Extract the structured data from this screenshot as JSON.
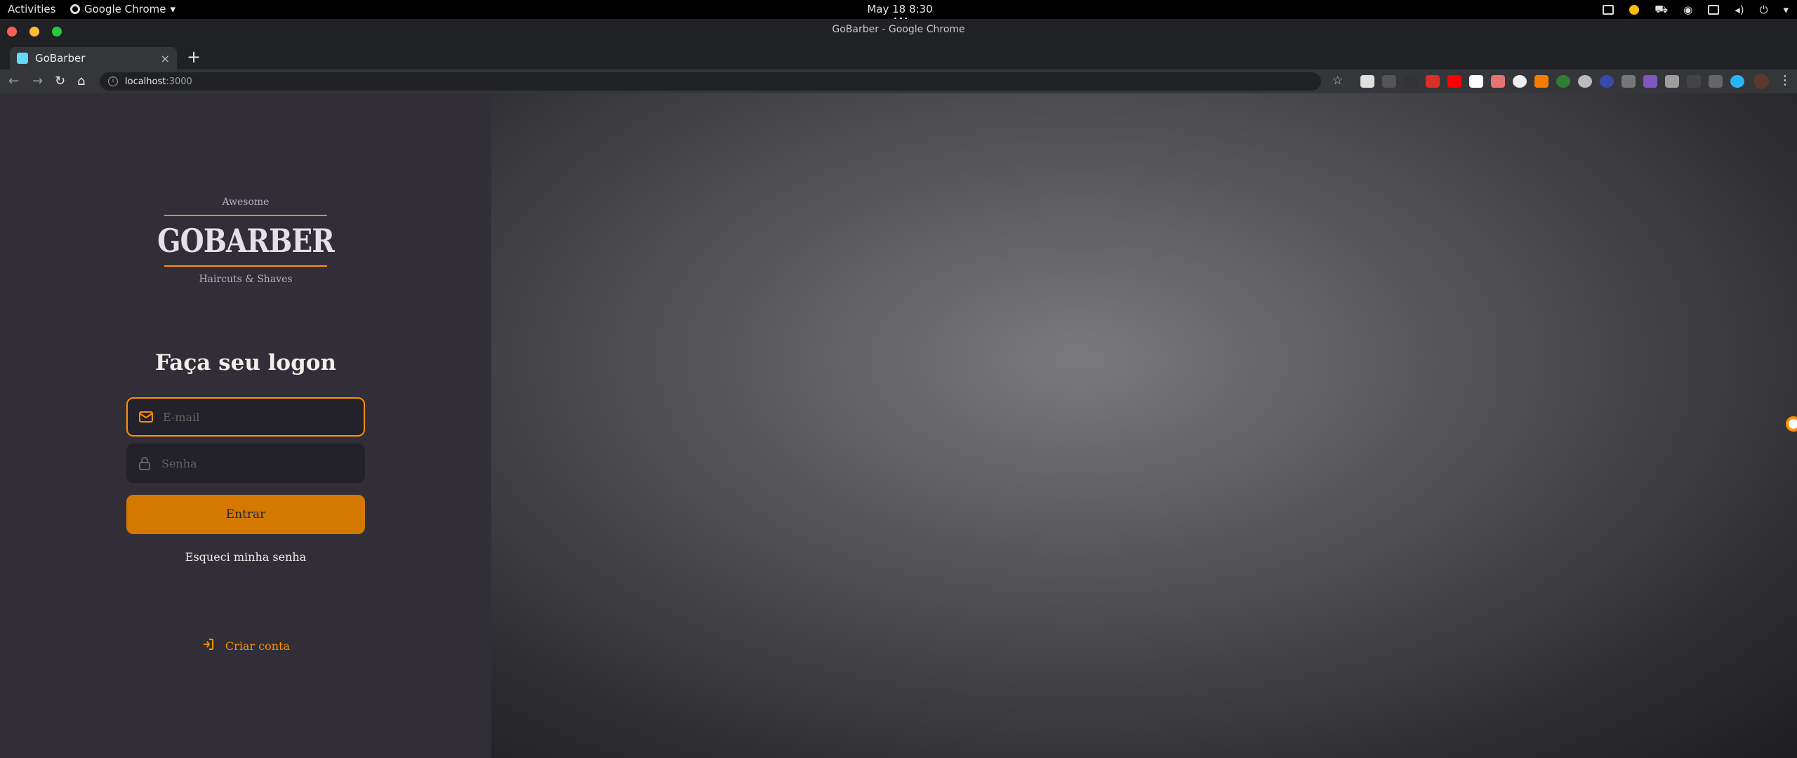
{
  "topbar": {
    "activities": "Activities",
    "app_name": "Google Chrome",
    "clock": "May 18  8:30 AM"
  },
  "window": {
    "title": "GoBarber - Google Chrome"
  },
  "tabs": [
    {
      "label": "GoBarber",
      "close": "×"
    }
  ],
  "toolbar": {
    "new_tab": "+",
    "url_host": "localhost",
    "url_port": ":3000",
    "star": "☆",
    "menu": "⋮"
  },
  "colors": {
    "accent": "#ff9000",
    "panel_bg": "#312e38",
    "input_bg": "#232129"
  },
  "logo": {
    "tagline_top": "Awesome",
    "brand": "GOBARBER",
    "tagline_bottom": "Haircuts & Shaves"
  },
  "login": {
    "title": "Faça seu logon",
    "email": {
      "placeholder": "E-mail",
      "icon": "mail-icon"
    },
    "password": {
      "placeholder": "Senha",
      "icon": "lock-icon"
    },
    "submit_label": "Entrar",
    "forgot_label": "Esqueci minha senha",
    "signup_label": "Criar conta",
    "signup_icon": "log-in-icon"
  }
}
